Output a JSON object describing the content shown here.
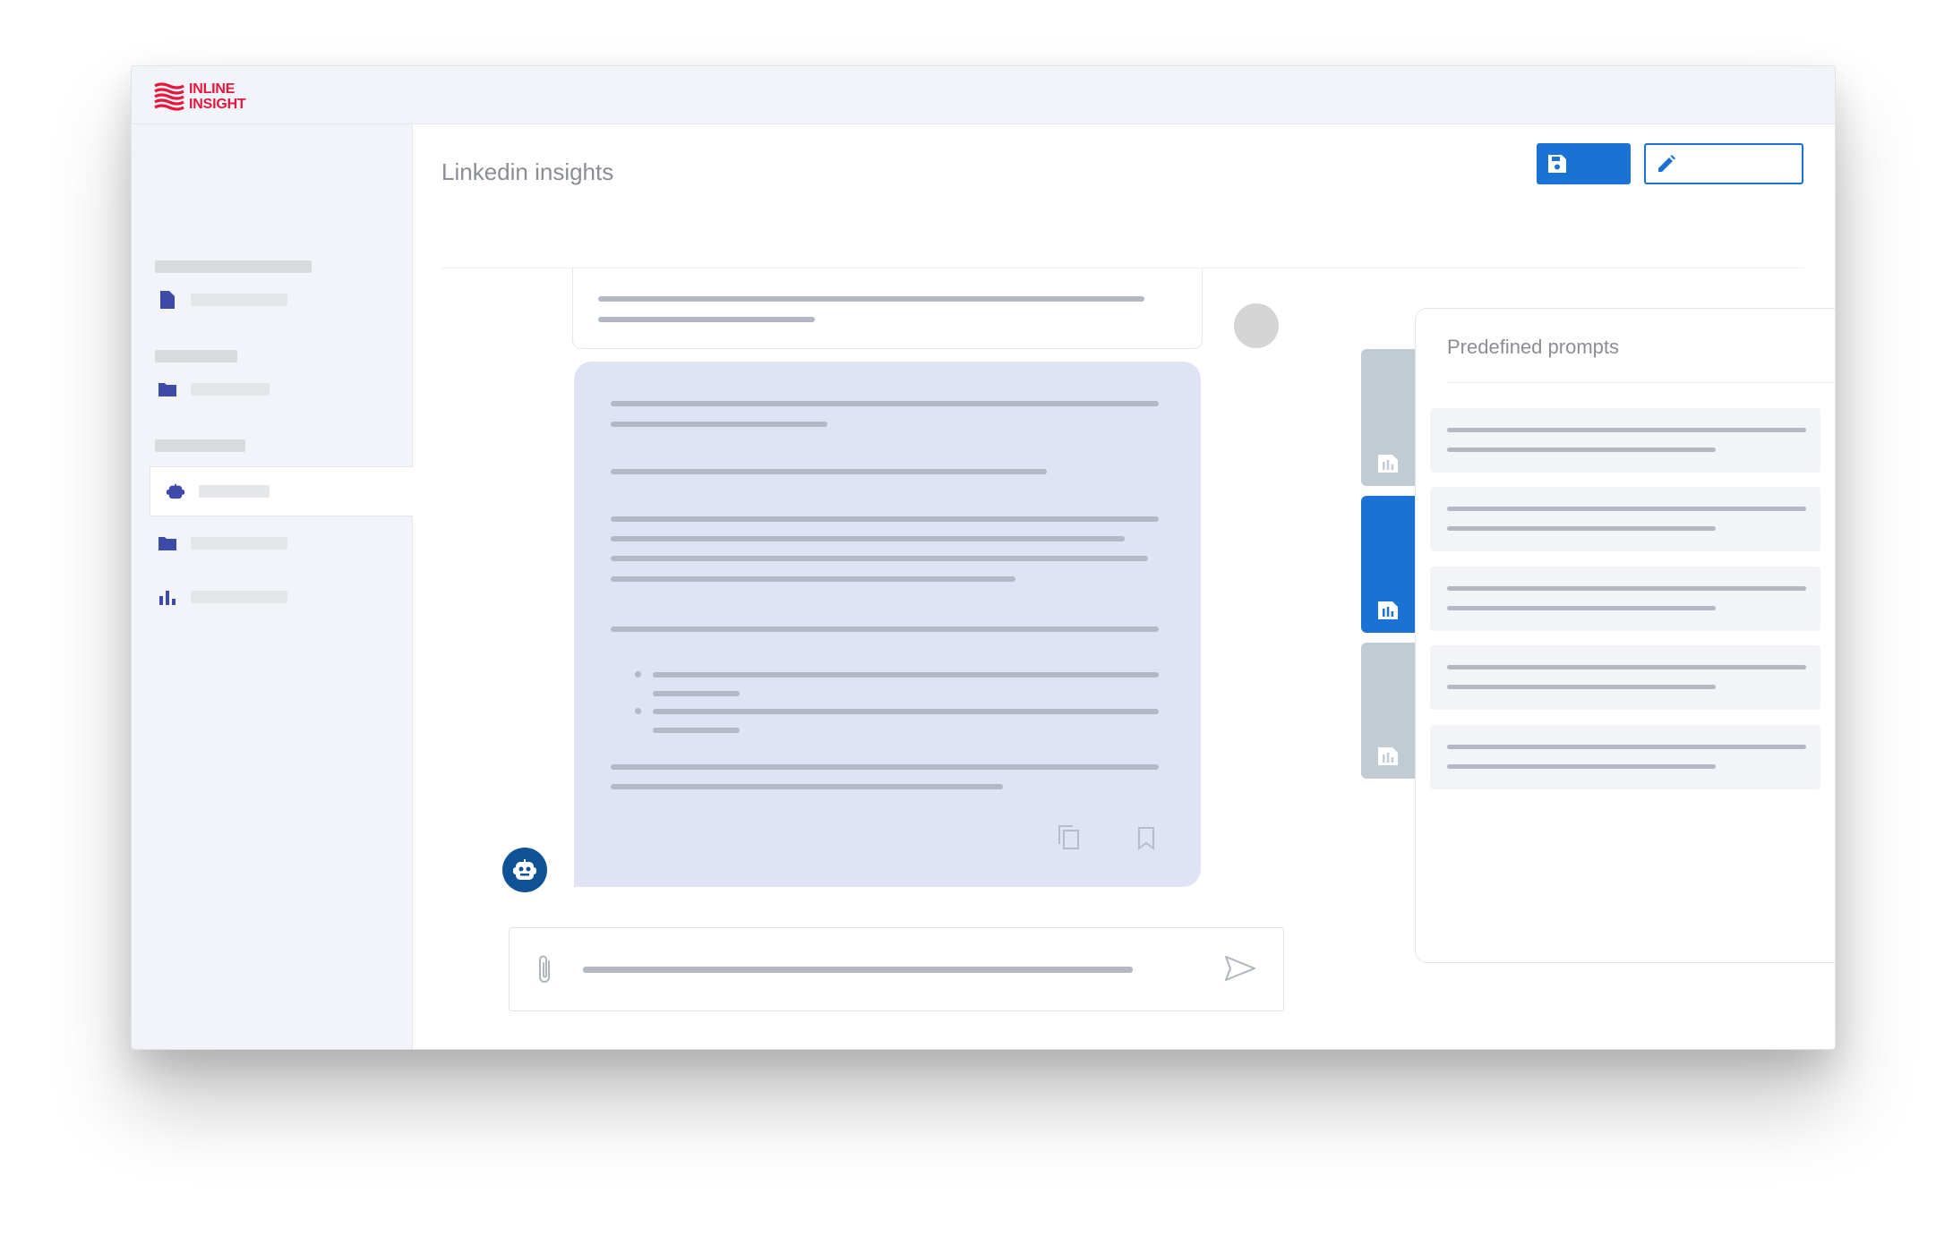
{
  "app": {
    "logo_text_line1": "INLINE",
    "logo_text_line2": "INSIGHT"
  },
  "main": {
    "page_title": "Linkedin insights"
  },
  "toolbar": {
    "save_icon": "floppy-disk-icon",
    "edit_icon": "pencil-icon"
  },
  "sidebar": {
    "items": [
      {
        "icon": "document-icon",
        "active": false
      },
      {
        "icon": "folder-icon",
        "active": false
      },
      {
        "icon": "robot-icon",
        "active": true
      },
      {
        "icon": "folder-icon",
        "active": false
      },
      {
        "icon": "bar-chart-icon",
        "active": false
      }
    ]
  },
  "chat": {
    "bot_actions": [
      "copy-icon",
      "bookmark-icon"
    ],
    "composer_icons": [
      "paperclip-icon",
      "send-icon"
    ]
  },
  "prompts_panel": {
    "title": "Predefined prompts",
    "item_count_visible": 5
  },
  "side_tabs": [
    {
      "icon": "report-icon",
      "active": false
    },
    {
      "icon": "report-icon",
      "active": true
    },
    {
      "icon": "report-icon",
      "active": false
    }
  ],
  "colors": {
    "brand_red": "#e6173d",
    "accent_blue": "#1a73d4",
    "bot_bubble": "#dfe3f3",
    "bot_avatar": "#0f5396",
    "tab_inactive": "#c0cbd3",
    "sidebar_bg": "#f2f4f9",
    "sidebar_icon": "#3d4aa8"
  }
}
